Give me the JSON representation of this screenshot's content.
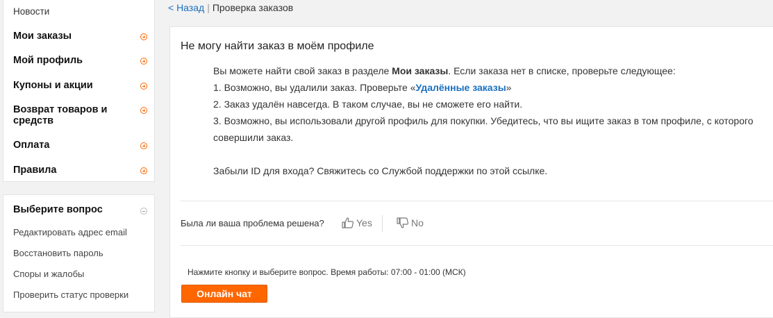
{
  "sidebar": {
    "news": "Новости",
    "items": [
      {
        "label": "Мои заказы"
      },
      {
        "label": "Мой профиль"
      },
      {
        "label": "Купоны и акции"
      },
      {
        "label": "Возврат товаров и средств"
      },
      {
        "label": "Оплата"
      },
      {
        "label": "Правила"
      }
    ]
  },
  "faq": {
    "title": "Выберите вопрос",
    "items": [
      "Редактировать адрес email",
      "Восстановить пароль",
      "Споры и жалобы",
      "Проверить статус проверки"
    ]
  },
  "breadcrumb": {
    "back": "< Назад",
    "separator": "|",
    "current": "Проверка заказов"
  },
  "article": {
    "title": "Не могу найти заказ в моём профиле",
    "intro_prefix": "Вы можете найти свой заказ в разделе ",
    "intro_bold": "Мои заказы",
    "intro_suffix": ". Если заказа нет в списке, проверьте следующее:",
    "step1_prefix": "1. Возможно, вы удалили заказ. Проверьте «",
    "step1_link": "Удалённые заказы",
    "step1_suffix": "»",
    "step2": "2.  Заказ удалён навсегда. В таком случае, вы не сможете его найти.",
    "step3": "3. Возможно, вы использовали другой профиль для покупки. Убедитесь, что вы ищите заказ в том профиле, с которого совершили заказ.",
    "forgot_id": "Забыли ID для входа? Свяжитесь со Службой поддержки по этой ссылке."
  },
  "feedback": {
    "question": "Была ли ваша проблема решена?",
    "yes": "Yes",
    "no": "No"
  },
  "support": {
    "hours": "Нажмите кнопку и выберите вопрос. Время работы: 07:00 - 01:00 (МСК)",
    "chat_button": "Онлайн чат"
  },
  "colors": {
    "accent": "#ff6600",
    "link": "#1a6fbf"
  }
}
